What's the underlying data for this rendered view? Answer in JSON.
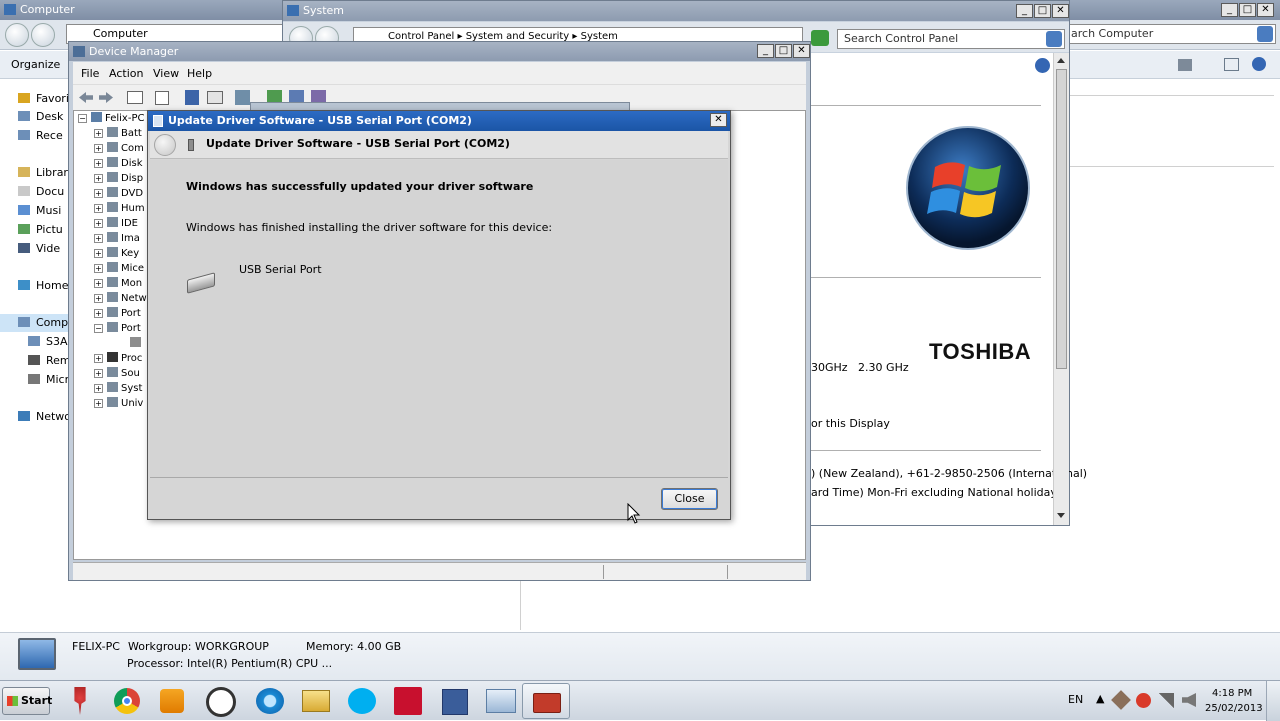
{
  "computer_window": {
    "title": "Computer",
    "breadcrumb": "Computer",
    "search_placeholder": "arch Computer",
    "organize_label": "Organize",
    "nav_items": [
      {
        "label": "Favori",
        "icon": "star-icon"
      },
      {
        "label": "Desk",
        "icon": "desktop-icon"
      },
      {
        "label": "Rece",
        "icon": "recent-places-icon"
      },
      {
        "label": "Librari",
        "icon": "libraries-icon"
      },
      {
        "label": "Docu",
        "icon": "documents-icon"
      },
      {
        "label": "Musi",
        "icon": "music-icon"
      },
      {
        "label": "Pictu",
        "icon": "pictures-icon"
      },
      {
        "label": "Vide",
        "icon": "videos-icon"
      },
      {
        "label": "Homeg",
        "icon": "homegroup-icon"
      },
      {
        "label": "Compu",
        "icon": "computer-icon"
      },
      {
        "label": "S3A",
        "icon": "drive-icon"
      },
      {
        "label": "Rem",
        "icon": "removable-drive-icon"
      },
      {
        "label": "Micr",
        "icon": "drive-icon"
      },
      {
        "label": "Netwo",
        "icon": "network-icon"
      }
    ],
    "details": {
      "name": "FELIX-PC",
      "workgroup": "Workgroup: WORKGROUP",
      "memory": "Memory: 4.00 GB",
      "processor": "Processor: Intel(R) Pentium(R) CPU ..."
    }
  },
  "system_window": {
    "title": "System",
    "breadcrumb": [
      "Control Panel",
      "System and Security",
      "System"
    ],
    "search_placeholder": "Search Control Panel",
    "brand": "TOSHIBA",
    "cpu_fragment": "30GHz   2.30 GHz",
    "display_fragment": "or this Display",
    "support_line1": ") (New Zealand), +61-2-9850-2506 (International)",
    "support_line2": "ard Time) Mon-Fri excluding National holidays"
  },
  "device_manager": {
    "title": "Device Manager",
    "menu": [
      "File",
      "Action",
      "View",
      "Help"
    ],
    "root": "Felix-PC",
    "tree": [
      "Batt",
      "Com",
      "Disk",
      "Disp",
      "DVD",
      "Hum",
      "IDE",
      "Ima",
      "Key",
      "Mice",
      "Mon",
      "Netw",
      "Port",
      "Port",
      "",
      "Proc",
      "Sou",
      "Syst",
      "Univ"
    ]
  },
  "update_dialog": {
    "title": "Update Driver Software - USB Serial Port (COM2)",
    "header": "Update Driver Software - USB Serial Port (COM2)",
    "success_heading": "Windows has successfully updated your driver software",
    "finished_text": "Windows has finished installing the driver software for this device:",
    "device_name": "USB Serial Port",
    "close_button": "Close"
  },
  "taskbar": {
    "start_label": "Start",
    "apps": [
      "pin-icon",
      "chrome-icon",
      "media-player-icon",
      "clock-app-icon",
      "internet-explorer-icon",
      "windows-explorer-icon",
      "skype-icon",
      "acrobat-icon",
      "save-disk-icon",
      "remote-desktop-icon",
      "toolbox-icon"
    ],
    "language": "EN",
    "time": "4:18 PM",
    "date": "25/02/2013"
  },
  "colors": {
    "title_active": "#1f5fb8",
    "title_inactive": "#8c9aae",
    "dialog_body": "#d4d4d4",
    "taskbar": "#d7dde5"
  }
}
